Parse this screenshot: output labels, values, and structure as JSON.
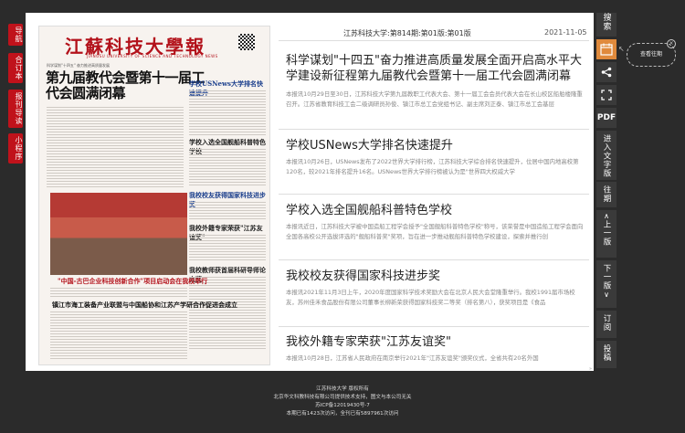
{
  "left_nav": {
    "nav": "导航",
    "combined": "合订本",
    "download": "报刊导读",
    "miniapp": "小程序"
  },
  "paper": {
    "masthead": "江蘇科技大學報",
    "masthead_en": "JIANGSU UNIVERSITY OF SCIENCE AND TECHNOLOGY NEWS",
    "headline": "第九届教代会暨第十一届工代会圆满闭幕",
    "sub": "科学谋划\"十四五\" 奋力推进高质量发展",
    "col1": "学校USNews大学排名快速提升",
    "col2": "学校入选全国舰船科普特色学校",
    "col3": "我校校友获得国家科技进步奖",
    "col4": "我校外籍专家荣获\"江苏友谊奖\"",
    "col5": "我校教师获首届科研导师论文奖",
    "photo_caption": "\"中国-古巴企业科技创新合作\"项目启动会在我校举行",
    "bottom_caption": "镇江市海工装备产业联盟与中国船协和江苏产学研合作促进会成立"
  },
  "header": {
    "issue": "江苏科技大学:第814期:第01版:第01版",
    "date": "2021-11-05"
  },
  "articles": [
    {
      "title": "科学谋划\"十四五\"奋力推进高质量发展全面开启高水平大学建设新征程第九届教代会暨第十一届工代会圆满闭幕",
      "body": "本报讯10月29日至30日，江苏科技大学第九届教职工代表大会、第十一届工会会员代表大会在长山校区船舶楼隆重召开。江苏省教育科技工会二级调研员孙俊、镇江市总工会党组书记、副主席刘正泰、镇江市总工会基层"
    },
    {
      "title": "学校USNews大学排名快速提升",
      "body": "本报讯10月26日，USNews发布了2022世界大学排行榜，江苏科技大学综合排名快速提升，位居中国内地高校第120名，较2021年排名提升16名。USNews世界大学排行榜被认为是\"世界四大权威大学"
    },
    {
      "title": "学校入选全国舰船科普特色学校",
      "body": "本报讯近日，江苏科技大学被中国造船工程学会授予\"全国舰船科普特色学校\"称号，该荣誉是中国造船工程学会面向全国各高校公开选拔评选的\"舰船科普奖\"奖项，旨在进一步推动舰船科普特色学校建设，探索并推行创"
    },
    {
      "title": "我校校友获得国家科技进步奖",
      "body": "本报讯2021年11月3日上午，2020年度国家科学技术奖励大会在北京人民大会堂隆重举行。我校1991届市场校友，苏州佳禾食品股份有限公司董事长柳新荣获得国家科技奖二等奖（排名第八），获奖项目是《食品"
    },
    {
      "title": "我校外籍专家荣获\"江苏友谊奖\"",
      "body": "本报讯10月28日，江苏省人民政府在南京举行2021年\"江苏友谊奖\"颁奖仪式，全省共有20名外国"
    }
  ],
  "more_arrow": "»",
  "right_tools": {
    "search": "搜索",
    "pdf": "PDF",
    "text_mode": "进入文字版",
    "past": "往期",
    "prev": "上一版",
    "next": "下一版",
    "subscribe": "订阅",
    "submit": "投稿",
    "hint": "查看往期"
  },
  "footer": {
    "line1": "江苏科技大学 版权所有",
    "line2": "北京华文科教科技有限公司提供技术支持，图文与本公司无关",
    "line3": "苏ICP备12019430号-7",
    "line4": "本期已有1423次访问，全刊已有5897961次访问"
  },
  "colors": {
    "accent_red": "#c0121b",
    "toolbar_orange": "#e08a3c",
    "background": "#2b2b2b"
  }
}
